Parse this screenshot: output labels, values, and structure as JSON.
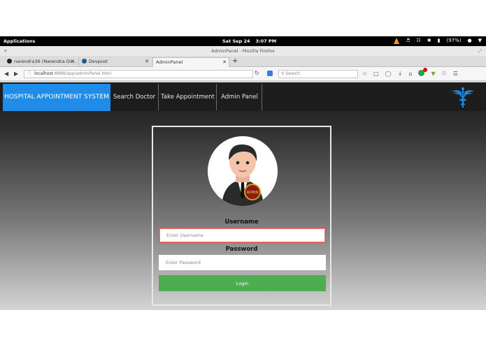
{
  "system_bar": {
    "applications": "Applications",
    "date": "Sat Sep 24",
    "time": "3:07 PM",
    "battery": "(97%)"
  },
  "window": {
    "title": "AdminPanel - Mozilla Firefox"
  },
  "tabs": [
    {
      "label": "narendra36 (Narendra Do...",
      "icon": "github-icon"
    },
    {
      "label": "Devpost",
      "icon": "devpost-icon"
    },
    {
      "label": "AdminPanel",
      "active": true
    }
  ],
  "navbar": {
    "url_host": "localhost",
    "url_path": ":8888/app/adminPanel.html",
    "search_placeholder": "Search"
  },
  "app": {
    "brand": "HOSPITAL APPOINTMENT SYSTEM",
    "nav": [
      "Search Doctor",
      "Take Appointment",
      "Admin Panel"
    ],
    "brand_color": "#1e8ce8"
  },
  "login": {
    "username_label": "Username",
    "username_placeholder": "Enter Username",
    "password_label": "Password",
    "password_placeholder": "Enter Password",
    "login_button": "Login",
    "button_color": "#4cae4f",
    "avatar_badge": "ADMIN"
  }
}
